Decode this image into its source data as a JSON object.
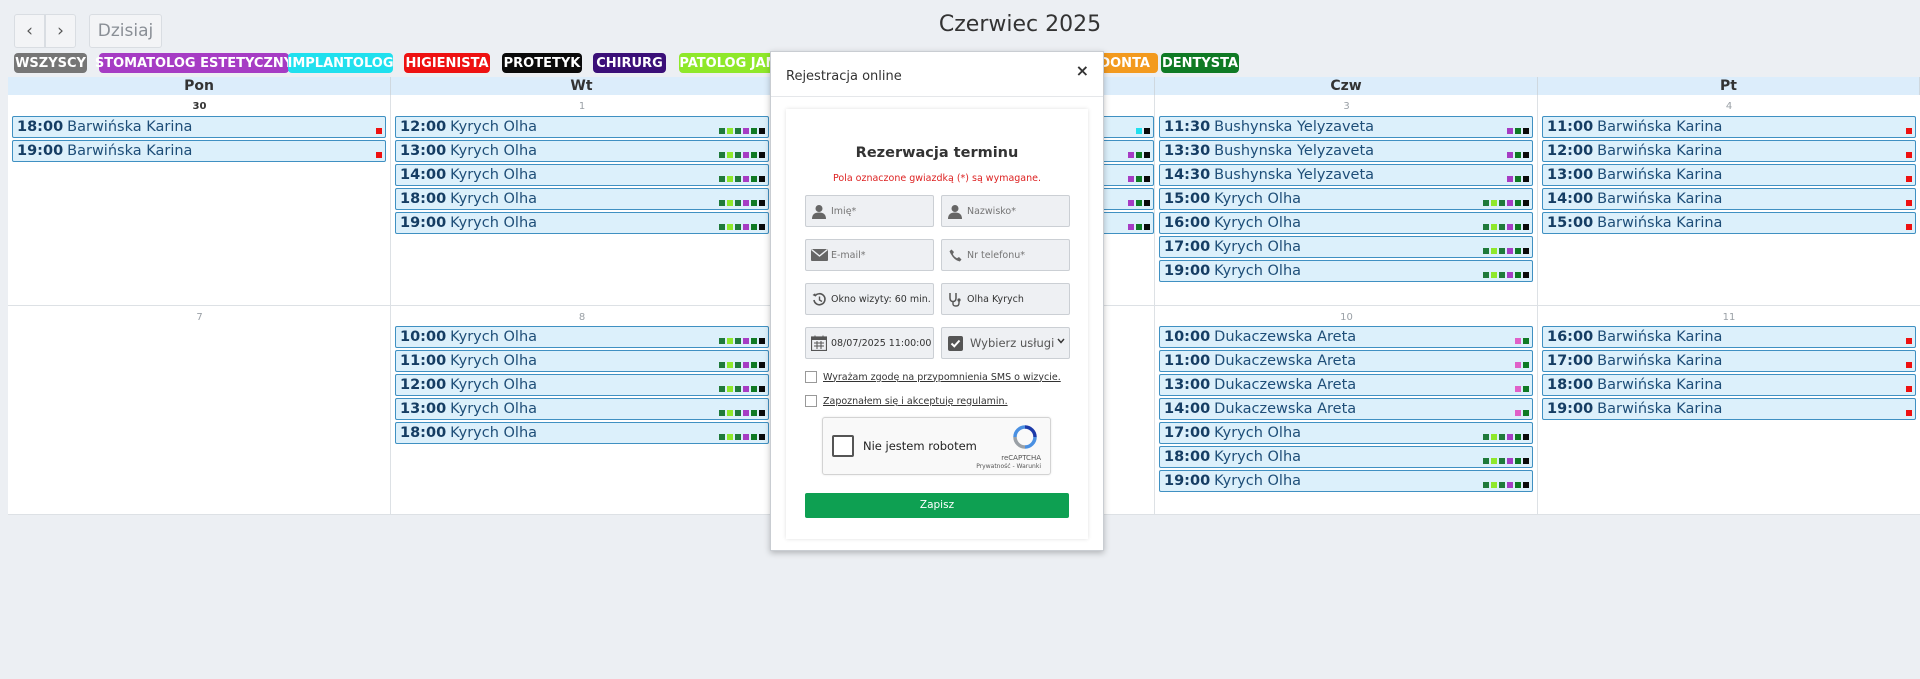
{
  "nav": {
    "prev": "‹",
    "next": "›",
    "today": "Dzisiaj"
  },
  "title": "Czerwiec 2025",
  "filters": [
    {
      "label": "WSZYSCY",
      "color": "#767676"
    },
    {
      "label": "STOMATOLOG ESTETYCZNY",
      "color": "#a63cc4"
    },
    {
      "label": "IMPLANTOLOG",
      "color": "#20e0ee"
    },
    {
      "label": "HIGIENISTA",
      "color": "#ee1111"
    },
    {
      "label": "PROTETYK",
      "color": "#0a0a0a"
    },
    {
      "label": "CHIRURG",
      "color": "#3b0f78"
    },
    {
      "label": "PATOLOG JAM",
      "color": "#8fe82a"
    },
    {
      "label": "DONTA",
      "color": "#f39a1e"
    },
    {
      "label": "DENTYSTA",
      "color": "#0f7a24"
    }
  ],
  "days": [
    "Pon",
    "Wt",
    "",
    "Czw",
    "Pt"
  ],
  "dates": {
    "week1": [
      "30",
      "1",
      "",
      "3",
      "4"
    ],
    "week2": [
      "7",
      "8",
      "",
      "10",
      "11"
    ]
  },
  "events": {
    "w1_pon": [
      {
        "time": "18:00",
        "name": "Barwińska Karina"
      },
      {
        "time": "19:00",
        "name": "Barwińska Karina"
      }
    ],
    "w1_wt": [
      {
        "time": "12:00",
        "name": "Kyrych Olha"
      },
      {
        "time": "13:00",
        "name": "Kyrych Olha"
      },
      {
        "time": "14:00",
        "name": "Kyrych Olha"
      },
      {
        "time": "18:00",
        "name": "Kyrych Olha"
      },
      {
        "time": "19:00",
        "name": "Kyrych Olha"
      }
    ],
    "w1_czw": [
      {
        "time": "11:30",
        "name": "Bushynska Yelyzaveta"
      },
      {
        "time": "13:30",
        "name": "Bushynska Yelyzaveta"
      },
      {
        "time": "14:30",
        "name": "Bushynska Yelyzaveta"
      },
      {
        "time": "15:00",
        "name": "Kyrych Olha"
      },
      {
        "time": "16:00",
        "name": "Kyrych Olha"
      },
      {
        "time": "17:00",
        "name": "Kyrych Olha"
      },
      {
        "time": "19:00",
        "name": "Kyrych Olha"
      }
    ],
    "w1_pt": [
      {
        "time": "11:00",
        "name": "Barwińska Karina"
      },
      {
        "time": "12:00",
        "name": "Barwińska Karina"
      },
      {
        "time": "13:00",
        "name": "Barwińska Karina"
      },
      {
        "time": "14:00",
        "name": "Barwińska Karina"
      },
      {
        "time": "15:00",
        "name": "Barwińska Karina"
      }
    ],
    "w2_wt": [
      {
        "time": "10:00",
        "name": "Kyrych Olha"
      },
      {
        "time": "11:00",
        "name": "Kyrych Olha"
      },
      {
        "time": "12:00",
        "name": "Kyrych Olha"
      },
      {
        "time": "13:00",
        "name": "Kyrych Olha"
      },
      {
        "time": "18:00",
        "name": "Kyrych Olha"
      }
    ],
    "w2_czw": [
      {
        "time": "10:00",
        "name": "Dukaczewska Areta"
      },
      {
        "time": "11:00",
        "name": "Dukaczewska Areta"
      },
      {
        "time": "13:00",
        "name": "Dukaczewska Areta"
      },
      {
        "time": "14:00",
        "name": "Dukaczewska Areta"
      },
      {
        "time": "17:00",
        "name": "Kyrych Olha"
      },
      {
        "time": "18:00",
        "name": "Kyrych Olha"
      },
      {
        "time": "19:00",
        "name": "Kyrych Olha"
      }
    ],
    "w2_pt": [
      {
        "time": "16:00",
        "name": "Barwińska Karina"
      },
      {
        "time": "17:00",
        "name": "Barwińska Karina"
      },
      {
        "time": "18:00",
        "name": "Barwińska Karina"
      },
      {
        "time": "19:00",
        "name": "Barwińska Karina"
      }
    ]
  },
  "marker_colors": {
    "karina": [
      "#ee1111"
    ],
    "olha": [
      "#1f7a3a",
      "#8fe82a",
      "#1f7a3a",
      "#a63cc4",
      "#0f7a24",
      "#0a0a0a"
    ],
    "bushynska": [
      "#a63cc4",
      "#0f7a24",
      "#0a0a0a"
    ],
    "areta": [
      "#e060c8",
      "#0f7a24"
    ],
    "hidden": [
      "#20e0ee",
      "#0a0a0a"
    ]
  },
  "modal": {
    "title": "Rejestracja online",
    "close": "×",
    "form_title": "Rezerwacja terminu",
    "required_note": "Pola oznaczone gwiazdką (*) są wymagane.",
    "first_name_placeholder": "Imię*",
    "last_name_placeholder": "Nazwisko*",
    "email_placeholder": "E-mail*",
    "phone_placeholder": "Nr telefonu*",
    "visit_window": "Okno wizyty: 60 min.",
    "doctor": "Olha Kyrych",
    "datetime": "08/07/2025 11:00:00",
    "services": "Wybierz usługi",
    "sms_consent": "Wyrażam zgodę na przypomnienia SMS o wizycie.",
    "terms_consent": "Zapoznałem się i akceptuję regulamin.",
    "captcha_label": "Nie jestem robotem",
    "captcha_brand": "reCAPTCHA",
    "captcha_links": "Prywatność - Warunki",
    "submit": "Zapisz"
  }
}
